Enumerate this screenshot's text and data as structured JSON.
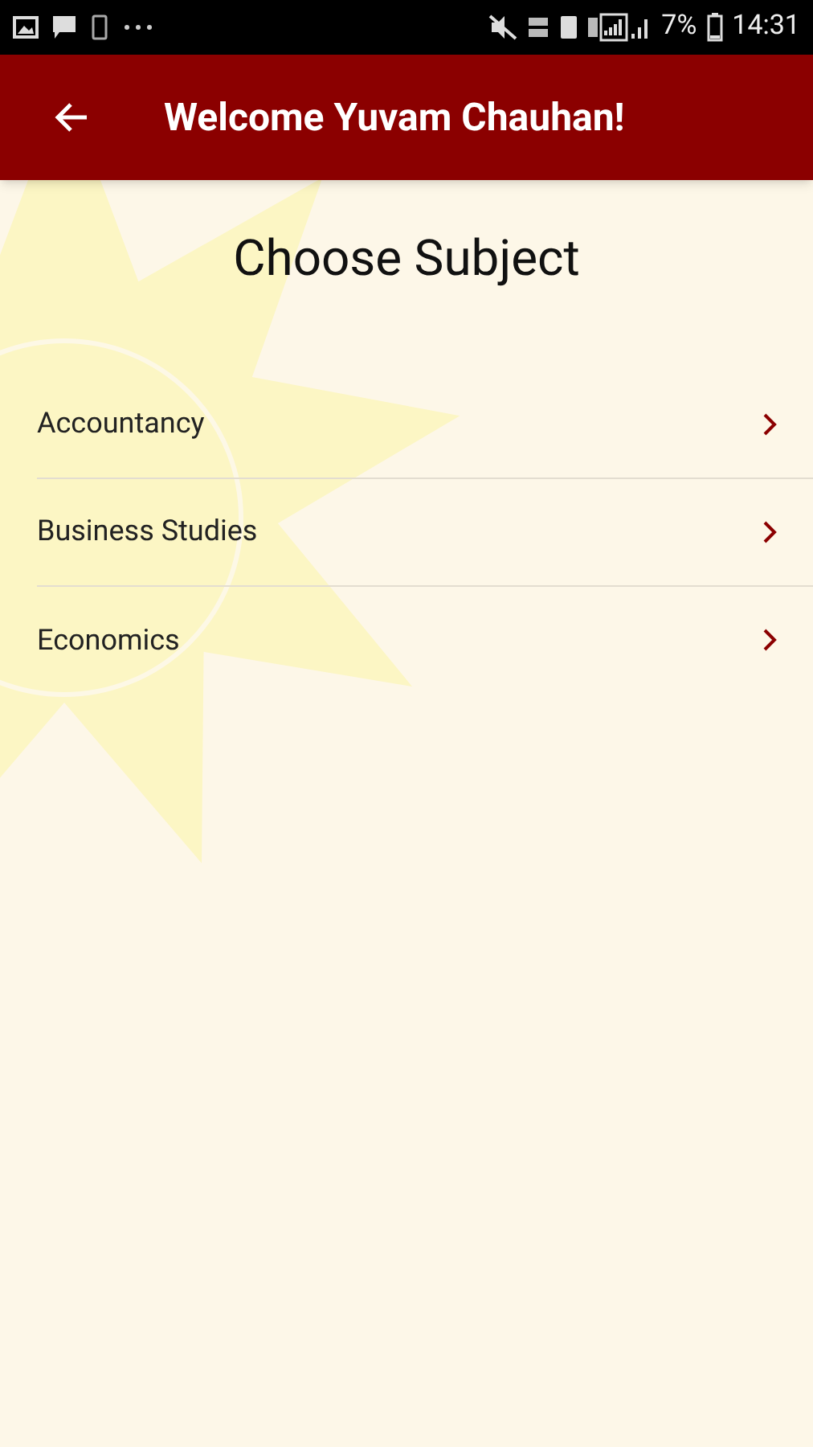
{
  "status_bar": {
    "battery": "7%",
    "time": "14:31"
  },
  "app_bar": {
    "title": "Welcome Yuvam Chauhan!"
  },
  "heading": "Choose Subject",
  "subjects": [
    {
      "label": "Accountancy"
    },
    {
      "label": "Business Studies"
    },
    {
      "label": "Economics"
    }
  ]
}
